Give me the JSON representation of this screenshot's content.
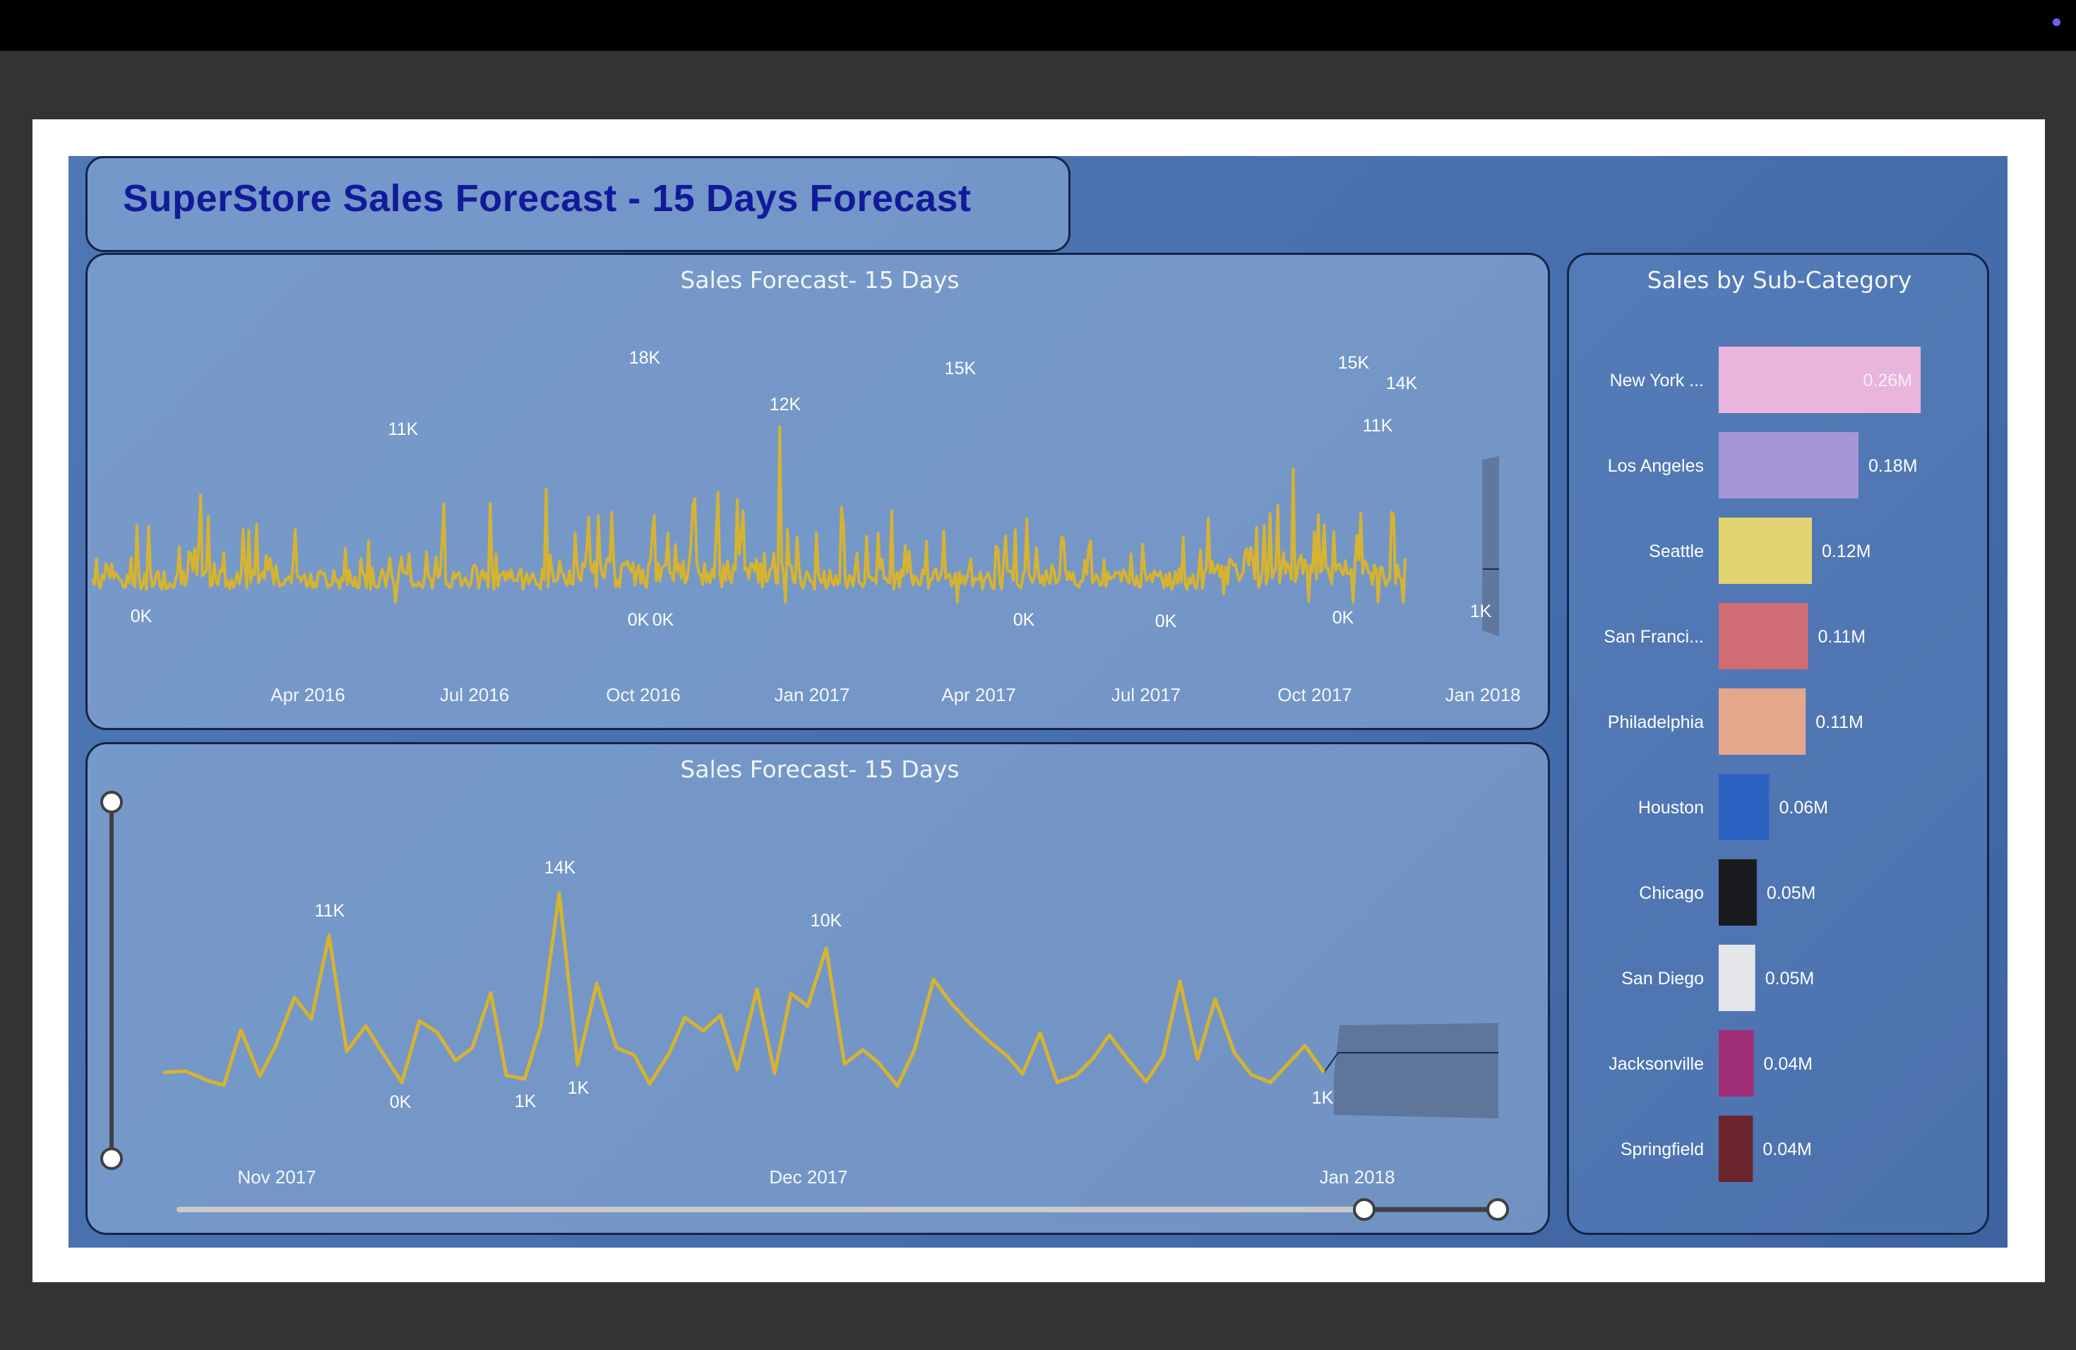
{
  "window": {
    "indicator_color": "#6e5ff5"
  },
  "dashboard": {
    "title": "SuperStore Sales Forecast - 15 Days Forecast",
    "colors": {
      "line": "#d6b330",
      "forecast_band": "#5d7397",
      "accent_title": "#121a9a"
    }
  },
  "top_chart": {
    "title": "Sales Forecast- 15 Days",
    "x_ticks": [
      "Apr 2016",
      "Jul 2016",
      "Oct 2016",
      "Jan 2017",
      "Apr 2017",
      "Jul 2017",
      "Oct 2017",
      "Jan 2018"
    ],
    "peak_labels": [
      "0K",
      "11K",
      "18K",
      "0K",
      "0K",
      "12K",
      "15K",
      "0K",
      "0K",
      "0K",
      "15K",
      "11K",
      "14K",
      "1K"
    ]
  },
  "bottom_chart": {
    "title": "Sales Forecast- 15 Days",
    "x_ticks": [
      "Nov 2017",
      "Dec 2017",
      "Jan 2018"
    ],
    "point_labels": [
      "11K",
      "0K",
      "14K",
      "1K",
      "1K",
      "10K",
      "1K"
    ]
  },
  "right_chart": {
    "title": "Sales by Sub-Category",
    "bars": [
      {
        "label": "New York ...",
        "value_label": "0.26M",
        "value": 0.26,
        "color": "#e9b5dc"
      },
      {
        "label": "Los Angeles",
        "value_label": "0.18M",
        "value": 0.18,
        "color": "#a696d6"
      },
      {
        "label": "Seattle",
        "value_label": "0.12M",
        "value": 0.12,
        "color": "#e2d471"
      },
      {
        "label": "San Franci...",
        "value_label": "0.11M",
        "value": 0.115,
        "color": "#d06c74"
      },
      {
        "label": "Philadelphia",
        "value_label": "0.11M",
        "value": 0.112,
        "color": "#e4a78c"
      },
      {
        "label": "Houston",
        "value_label": "0.06M",
        "value": 0.065,
        "color": "#2d62c3"
      },
      {
        "label": "Chicago",
        "value_label": "0.05M",
        "value": 0.049,
        "color": "#1a1b1e"
      },
      {
        "label": "San Diego",
        "value_label": "0.05M",
        "value": 0.047,
        "color": "#e5e6ea"
      },
      {
        "label": "Jacksonville",
        "value_label": "0.04M",
        "value": 0.045,
        "color": "#a02d78"
      },
      {
        "label": "Springfield",
        "value_label": "0.04M",
        "value": 0.044,
        "color": "#6a262c"
      }
    ]
  }
}
